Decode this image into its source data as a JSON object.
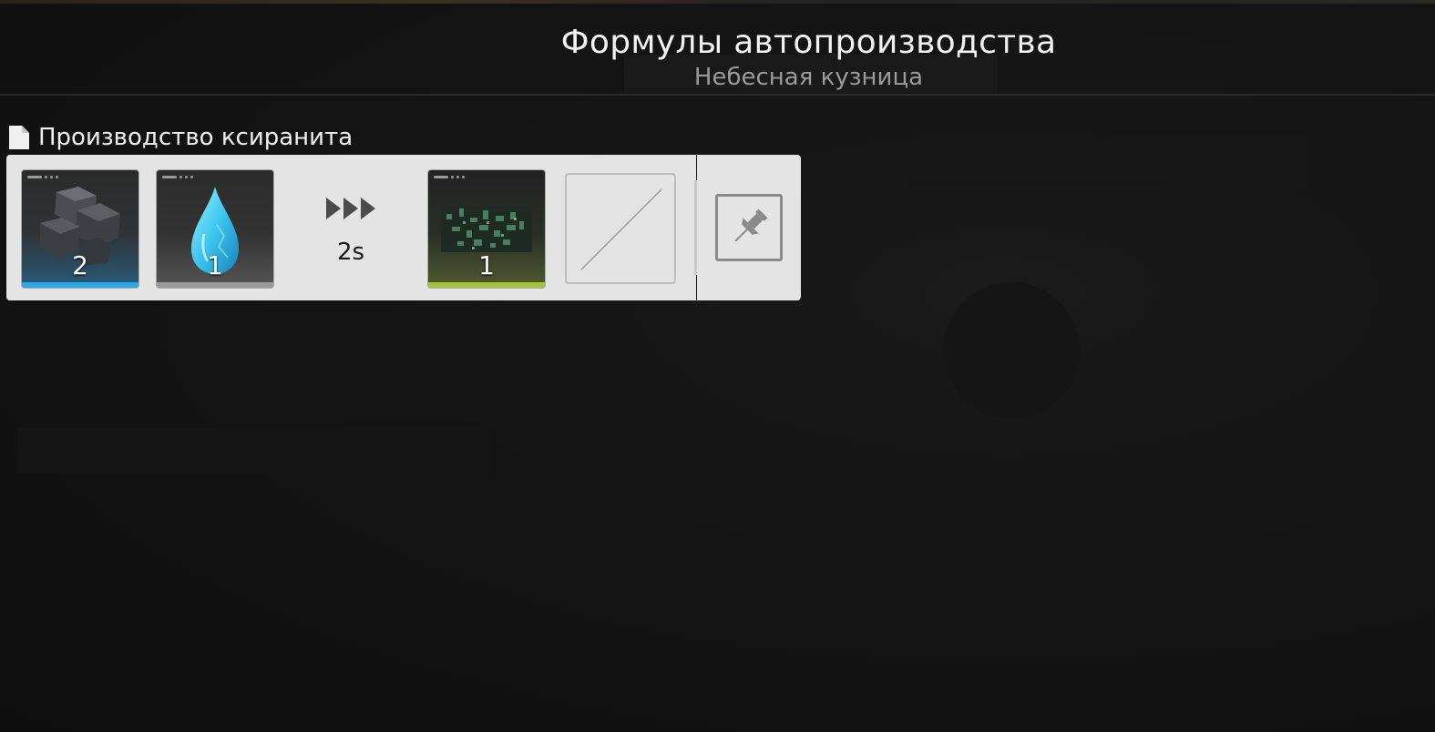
{
  "header": {
    "title": "Формулы автопроизводства",
    "subtitle": "Небесная кузница"
  },
  "formula": {
    "name": "Производство ксиранита",
    "icon": "document-icon",
    "inputs": [
      {
        "icon": "stone-ore-icon",
        "quantity": "2",
        "rarity_color": "#2ba9e8"
      },
      {
        "icon": "water-drop-icon",
        "quantity": "1",
        "rarity_color": "#9a9a9a"
      }
    ],
    "arrow_icon": "triple-arrow-icon",
    "duration": "2s",
    "outputs": [
      {
        "icon": "xiranite-crystal-icon",
        "quantity": "1",
        "rarity_color": "#a5c33a"
      }
    ],
    "empty_slot_icon": "empty-slot-icon",
    "pin_icon": "pin-icon"
  }
}
